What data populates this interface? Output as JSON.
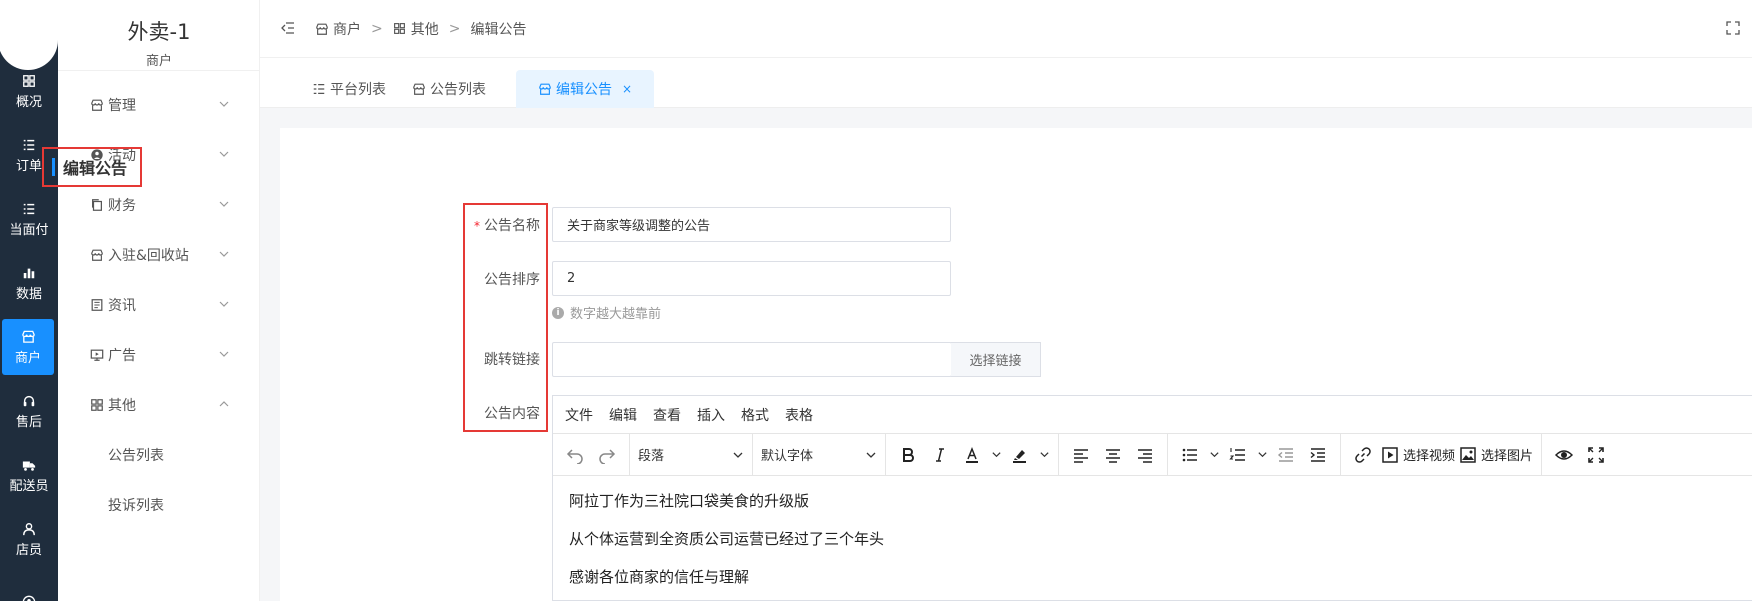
{
  "rail": {
    "items": [
      {
        "label": "概况",
        "icon": "dashboard-icon"
      },
      {
        "label": "订单",
        "icon": "list-icon"
      },
      {
        "label": "当面付",
        "icon": "list-icon"
      },
      {
        "label": "数据",
        "icon": "bar-chart-icon"
      },
      {
        "label": "商户",
        "icon": "store-icon",
        "active": true
      },
      {
        "label": "售后",
        "icon": "headset-icon"
      },
      {
        "label": "配送员",
        "icon": "delivery-icon"
      },
      {
        "label": "店员",
        "icon": "user-icon"
      }
    ]
  },
  "sidebar": {
    "title": "外卖-1",
    "subtitle": "商户",
    "menus": [
      {
        "label": "管理",
        "icon": "store-icon"
      },
      {
        "label": "活动",
        "icon": "user-circle-icon"
      },
      {
        "label": "财务",
        "icon": "copy-icon"
      },
      {
        "label": "入驻&回收站",
        "icon": "store-icon"
      },
      {
        "label": "资讯",
        "icon": "news-icon"
      },
      {
        "label": "广告",
        "icon": "monitor-icon"
      },
      {
        "label": "其他",
        "icon": "grid-icon",
        "expanded": true
      }
    ],
    "submenus": [
      "公告列表",
      "投诉列表"
    ]
  },
  "breadcrumb": [
    "商户",
    "其他",
    "编辑公告"
  ],
  "breadcrumb_sep": ">",
  "tabs": [
    {
      "label": "平台列表"
    },
    {
      "label": "公告列表"
    },
    {
      "label": "编辑公告",
      "active": true
    }
  ],
  "tab_close": "×",
  "form": {
    "section_title": "编辑公告",
    "required_mark": "*",
    "name_label": "公告名称",
    "name_value": "关于商家等级调整的公告",
    "sort_label": "公告排序",
    "sort_value": "2",
    "sort_hint": "数字越大越靠前",
    "link_label": "跳转链接",
    "link_value": "",
    "link_button": "选择链接",
    "content_label": "公告内容"
  },
  "editor": {
    "menus": [
      "文件",
      "编辑",
      "查看",
      "插入",
      "格式",
      "表格"
    ],
    "block_format": "段落",
    "font_family": "默认字体",
    "video_button": "选择视频",
    "image_button": "选择图片",
    "paragraphs": [
      "阿拉丁作为三社院口袋美食的升级版",
      "从个体运营到全资质公司运营已经过了三个年头",
      "感谢各位商家的信任与理解"
    ]
  },
  "colors": {
    "primary": "#1890ff",
    "rail_bg": "#1f2d3d",
    "highlight_border": "#e53935"
  }
}
